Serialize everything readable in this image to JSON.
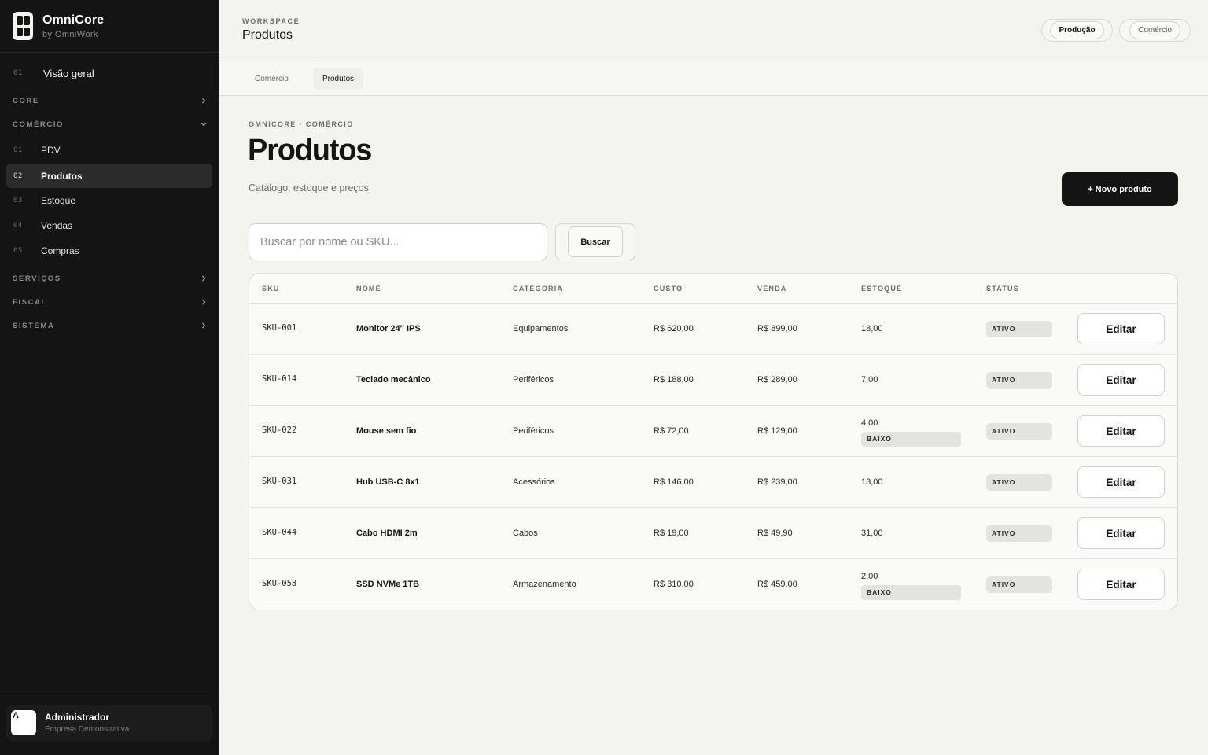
{
  "brand": {
    "name": "OmniCore",
    "sub": "by OmniWork"
  },
  "sidebar": {
    "overview": {
      "num": "01",
      "label": "Visão geral"
    },
    "sections": [
      {
        "label": "CORE",
        "state": "collapsed"
      },
      {
        "label": "COMÉRCIO",
        "state": "expanded"
      },
      {
        "label": "SERVIÇOS",
        "state": "collapsed"
      },
      {
        "label": "FISCAL",
        "state": "collapsed"
      },
      {
        "label": "SISTEMA",
        "state": "collapsed"
      }
    ],
    "items": [
      {
        "num": "01",
        "label": "PDV"
      },
      {
        "num": "02",
        "label": "Produtos",
        "active": true
      },
      {
        "num": "03",
        "label": "Estoque"
      },
      {
        "num": "04",
        "label": "Vendas"
      },
      {
        "num": "05",
        "label": "Compras"
      }
    ],
    "user": {
      "initial": "A",
      "name": "Administrador",
      "org": "Empresa Demonstrativa"
    }
  },
  "header": {
    "label": "WORKSPACE",
    "title": "Produtos",
    "pills": [
      "Produção",
      "Comércio"
    ]
  },
  "tabs": [
    "Comércio",
    "Produtos"
  ],
  "page": {
    "crumb": "OMNICORE · COMÉRCIO",
    "title": "Produtos",
    "subtitle": "Catálogo, estoque e preços",
    "new_button": "+ Novo produto",
    "search_placeholder": "Buscar por nome ou SKU...",
    "search_button": "Buscar"
  },
  "table": {
    "headers": [
      "SKU",
      "NOME",
      "CATEGORIA",
      "CUSTO",
      "VENDA",
      "ESTOQUE",
      "STATUS"
    ],
    "edit_label": "Editar",
    "rows": [
      {
        "sku": "SKU-001",
        "name": "Monitor 24″ IPS",
        "category": "Equipamentos",
        "cost": "R$ 620,00",
        "sale": "R$ 899,00",
        "stock": "18,00",
        "low": "",
        "status": "ATIVO"
      },
      {
        "sku": "SKU-014",
        "name": "Teclado mecânico",
        "category": "Periféricos",
        "cost": "R$ 188,00",
        "sale": "R$ 289,00",
        "stock": "7,00",
        "low": "",
        "status": "ATIVO"
      },
      {
        "sku": "SKU-022",
        "name": "Mouse sem fio",
        "category": "Periféricos",
        "cost": "R$ 72,00",
        "sale": "R$ 129,00",
        "stock": "4,00",
        "low": "BAIXO",
        "status": "ATIVO"
      },
      {
        "sku": "SKU-031",
        "name": "Hub USB-C 8x1",
        "category": "Acessórios",
        "cost": "R$ 146,00",
        "sale": "R$ 239,00",
        "stock": "13,00",
        "low": "",
        "status": "ATIVO"
      },
      {
        "sku": "SKU-044",
        "name": "Cabo HDMI 2m",
        "category": "Cabos",
        "cost": "R$ 19,00",
        "sale": "R$ 49,90",
        "stock": "31,00",
        "low": "",
        "status": "ATIVO"
      },
      {
        "sku": "SKU-058",
        "name": "SSD NVMe 1TB",
        "category": "Armazenamento",
        "cost": "R$ 310,00",
        "sale": "R$ 459,00",
        "stock": "2,00",
        "low": "BAIXO",
        "status": "ATIVO"
      }
    ]
  }
}
